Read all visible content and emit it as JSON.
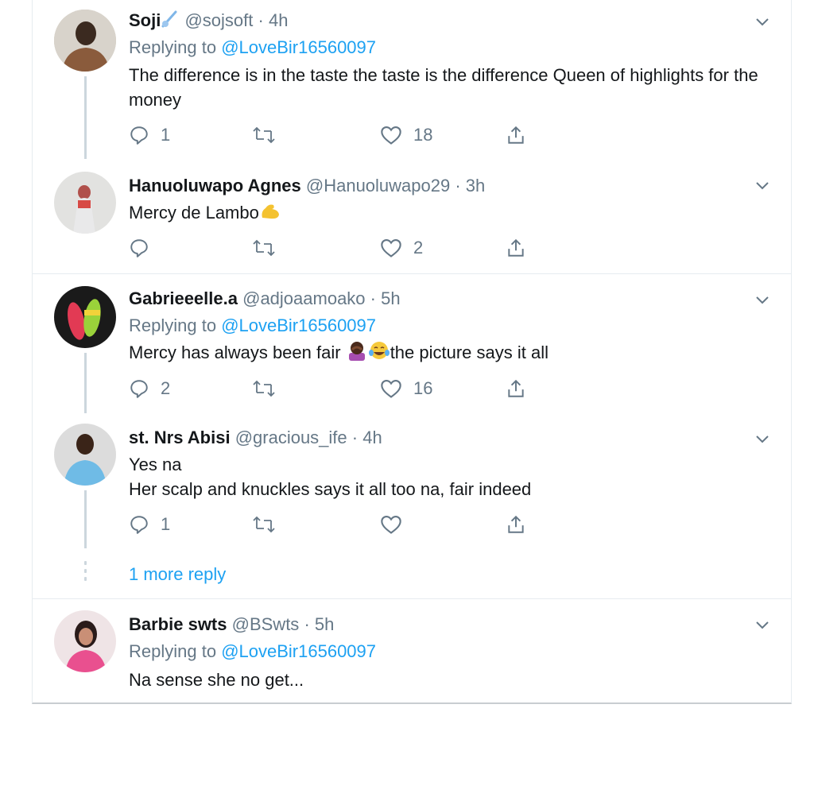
{
  "tweets": [
    {
      "name": "Soji",
      "handle": "@sojsoft",
      "time": "· 4h",
      "replying_label": "Replying to",
      "replying_to": "@LoveBir16560097",
      "text": "The difference is in the taste the taste is the difference Queen of highlights for the money",
      "replies": "1",
      "retweets": "",
      "likes": "18"
    },
    {
      "name": "Hanuoluwapo Agnes",
      "handle": "@Hanuoluwapo29",
      "time": "· 3h",
      "text": "Mercy de Lambo",
      "replies": "",
      "retweets": "",
      "likes": "2"
    },
    {
      "name": "Gabrieeelle.a",
      "handle": "@adjoaamoako",
      "time": "· 5h",
      "replying_label": "Replying to",
      "replying_to": "@LoveBir16560097",
      "text_before": "Mercy has always been fair",
      "text_after": "the picture says it all",
      "replies": "2",
      "retweets": "",
      "likes": "16"
    },
    {
      "name": "st. Nrs Abisi",
      "handle": "@gracious_ife",
      "time": "· 4h",
      "text_line1": "Yes na",
      "text_line2": "Her scalp and knuckles says it all too na, fair indeed",
      "replies": "1",
      "retweets": "",
      "likes": ""
    },
    {
      "name": "Barbie swts",
      "handle": "@BSwts",
      "time": "· 5h",
      "replying_label": "Replying to",
      "replying_to": "@LoveBir16560097",
      "text": "Na sense she no get..."
    }
  ],
  "more_replies": "1 more reply",
  "colors": {
    "link": "#1da1f2",
    "muted": "#657786",
    "thread_line": "#ccd6dd",
    "border": "#e6ecf0"
  },
  "icons": [
    "reply-icon",
    "retweet-icon",
    "like-icon",
    "share-icon",
    "chevron-down-icon",
    "comet-emoji",
    "flexed-bicep-emoji",
    "facepalm-emoji",
    "tears-of-joy-emoji"
  ]
}
